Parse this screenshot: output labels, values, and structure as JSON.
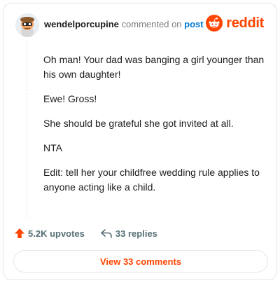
{
  "header": {
    "username": "wendelporcupine",
    "action_text": "commented on",
    "post_link": "post"
  },
  "logo": {
    "icon": "reddit-snoo-icon",
    "wordmark": "reddit"
  },
  "comment": {
    "paragraphs": [
      "Oh man! Your dad was banging a girl younger than his own daughter!",
      "Ewe! Gross!",
      "She should be grateful she got invited at all.",
      "NTA",
      "Edit: tell her your childfree wedding rule applies to anyone acting like a child."
    ]
  },
  "stats": {
    "upvotes": "5.2K upvotes",
    "upvote_icon": "upvote-arrow-icon",
    "replies": "33 replies",
    "reply_icon": "reply-arrow-icon"
  },
  "view_button": {
    "label": "View 33 comments"
  },
  "colors": {
    "brand": "#ff4500",
    "link": "#0079d3",
    "muted": "#576f76"
  }
}
